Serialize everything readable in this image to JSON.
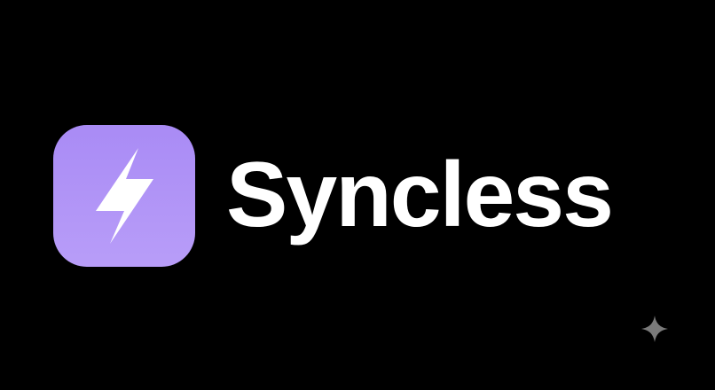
{
  "brand": {
    "name": "Syncless",
    "icon": "lightning-bolt-icon",
    "icon_background": "#b298f7",
    "icon_glyph_color": "#ffffff",
    "text_color": "#ffffff"
  },
  "background_color": "#000000",
  "watermark": {
    "icon": "sparkle-icon",
    "color": "#7a7a7a"
  }
}
